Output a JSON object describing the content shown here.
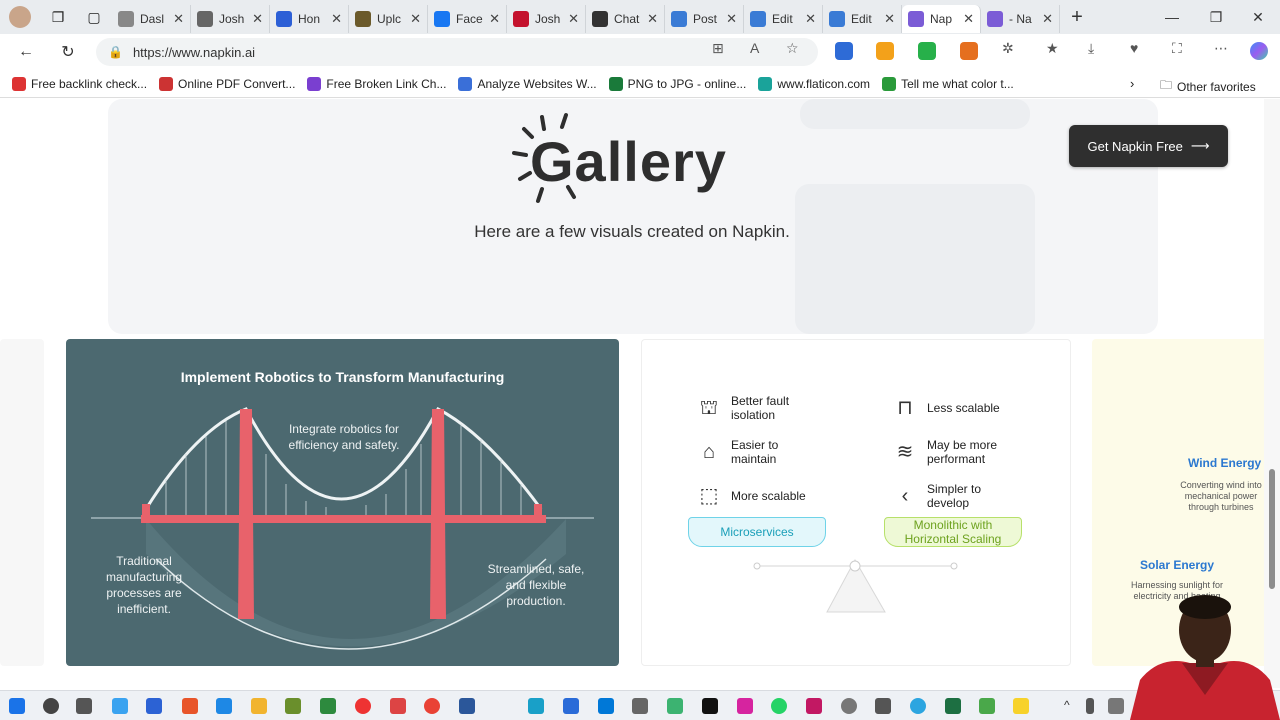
{
  "browser": {
    "tabs": [
      {
        "label": "Dasl",
        "color": "#888"
      },
      {
        "label": "Josh",
        "color": "#666"
      },
      {
        "label": "Hon",
        "color": "#2c5fd6"
      },
      {
        "label": "Uplc",
        "color": "#6b5a2b"
      },
      {
        "label": "Face",
        "color": "#1877f2"
      },
      {
        "label": "Josh",
        "color": "#c4122d"
      },
      {
        "label": "Chat",
        "color": "#333"
      },
      {
        "label": "Post",
        "color": "#3a7bd5"
      },
      {
        "label": "Edit",
        "color": "#3a7bd5"
      },
      {
        "label": "Edit",
        "color": "#3a7bd5"
      },
      {
        "label": "Nap",
        "color": "#7b5cd6"
      },
      {
        "label": "- Na",
        "color": "#7b5cd6"
      }
    ],
    "active_tab": 10,
    "url": "https://www.napkin.ai",
    "favorites": [
      {
        "label": "Free backlink check...",
        "color": "#d33"
      },
      {
        "label": "Online PDF Convert...",
        "color": "#c33"
      },
      {
        "label": "Free Broken Link Ch...",
        "color": "#7a3fd0"
      },
      {
        "label": "Analyze Websites W...",
        "color": "#3a6fd8"
      },
      {
        "label": "PNG to JPG - online...",
        "color": "#1a7a3a"
      },
      {
        "label": "www.flaticon.com",
        "color": "#1aa39a"
      },
      {
        "label": "Tell me what color t...",
        "color": "#2a9a3a"
      }
    ],
    "other_favorites": "Other favorites"
  },
  "page": {
    "gallery_title": "Gallery",
    "subtitle": "Here are a few visuals created on Napkin.",
    "cta_label": "Get Napkin Free",
    "card1": {
      "title": "Implement Robotics to Transform Manufacturing",
      "top_text": "Integrate robotics for efficiency and safety.",
      "left_text": "Traditional manufacturing processes are inefficient.",
      "right_text": "Streamlined, safe, and flexible production."
    },
    "card2": {
      "left_items": [
        "Better fault isolation",
        "Easier to maintain",
        "More scalable"
      ],
      "right_items": [
        "Less scalable",
        "May be more performant",
        "Simpler to develop"
      ],
      "left_pill": "Microservices",
      "right_pill": "Monolithic with Horizontal Scaling"
    },
    "card3": {
      "wind_title": "Wind Energy",
      "wind_text": "Converting wind into mechanical power through turbines",
      "solar_title": "Solar Energy",
      "solar_text": "Harnessing sunlight for electricity and heating"
    }
  },
  "colors": {
    "card1_bg": "#4c6970",
    "bridge_red": "#e8626b",
    "pill_blue": "#6fd3e8",
    "pill_green": "#c8ea7a",
    "accent_blue": "#2b78d0"
  }
}
